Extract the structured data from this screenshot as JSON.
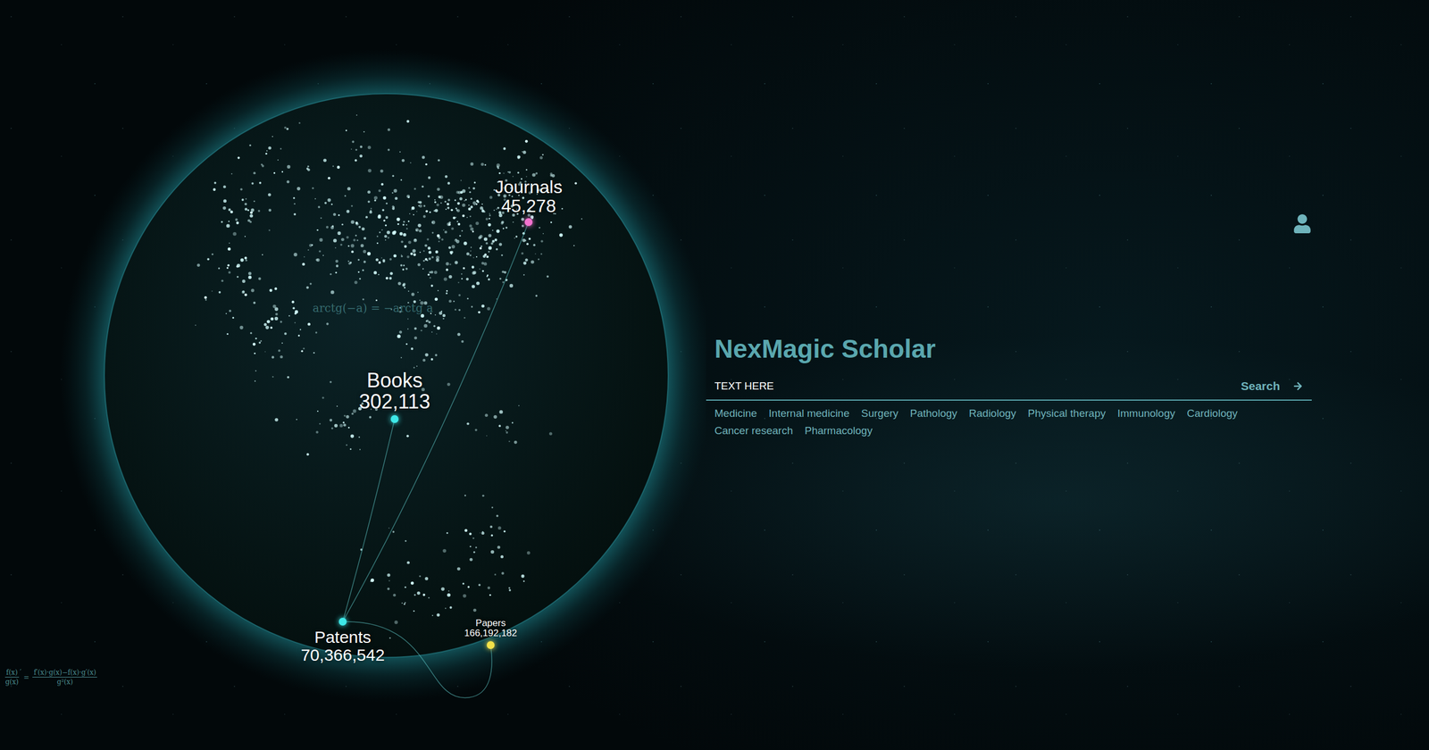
{
  "app": {
    "title": "NexMagic Scholar"
  },
  "search": {
    "value": "TEXT HERE",
    "button": "Search"
  },
  "tags": [
    "Medicine",
    "Internal medicine",
    "Surgery",
    "Pathology",
    "Radiology",
    "Physical therapy",
    "Immunology",
    "Cardiology",
    "Cancer research",
    "Pharmacology"
  ],
  "globe": {
    "pins": [
      {
        "label": "Journals",
        "count": "45,278",
        "color": "#f472d0"
      },
      {
        "label": "Books",
        "count": "302,113",
        "color": "#3ee8e8"
      },
      {
        "label": "Patents",
        "count": "70,366,542",
        "color": "#3ee8e8"
      },
      {
        "label": "Papers",
        "count": "166,192,182",
        "color": "#f2e24a"
      }
    ],
    "formulas": {
      "inline": "arctg(−a) = −arctg a",
      "quotient": {
        "lhs_num": "f(x)",
        "lhs_den": "g(x)",
        "prime": "′",
        "equals": "=",
        "rhs_num": "f′(x)·g(x)−f(x)·g′(x)",
        "rhs_den": "g²(x)"
      }
    }
  }
}
